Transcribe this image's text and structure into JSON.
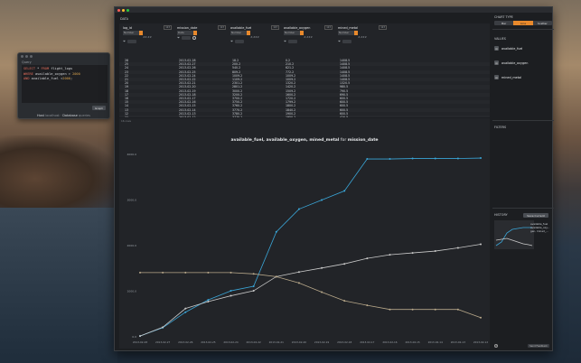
{
  "query_window": {
    "label": "Query",
    "sql_lines": [
      [
        {
          "t": "SELECT ",
          "c": "kw"
        },
        {
          "t": "* ",
          "c": "plain"
        },
        {
          "t": "FROM ",
          "c": "kw"
        },
        {
          "t": "flight_logs",
          "c": "plain"
        }
      ],
      [
        {
          "t": "WHERE ",
          "c": "kw"
        },
        {
          "t": "available_oxygen ",
          "c": "plain"
        },
        {
          "t": "> ",
          "c": "plain"
        },
        {
          "t": "2000",
          "c": "num"
        }
      ],
      [
        {
          "t": "AND ",
          "c": "kw"
        },
        {
          "t": "available_fuel ",
          "c": "plain"
        },
        {
          "t": "<",
          "c": "plain"
        },
        {
          "t": "2000",
          "c": "num"
        },
        {
          "t": ";",
          "c": "plain"
        }
      ]
    ],
    "run_label": "Graph",
    "footer_main": "Host",
    "footer_localhost": "localhost",
    "footer_db": "Database",
    "footer_queries": "queries"
  },
  "main": {
    "data_title": "DATA",
    "columns": [
      {
        "name": "log_id",
        "type": "Number",
        "sub": "##.##",
        "tag": "123"
      },
      {
        "name": "mission_date",
        "type": "Date",
        "sub": "",
        "tag": "123"
      },
      {
        "name": "available_fuel",
        "type": "Number",
        "sub": "#,###",
        "tag": "123"
      },
      {
        "name": "available_oxygen",
        "type": "Number",
        "sub": "#,###",
        "tag": "123"
      },
      {
        "name": "mined_metal",
        "type": "Number",
        "sub": "#,###",
        "tag": "123"
      }
    ],
    "rows": [
      [
        "28",
        "2013-02-28",
        "18.2",
        "0.2",
        "1408.5"
      ],
      [
        "25",
        "2013-02-27",
        "200.2",
        "210.2",
        "1408.5"
      ],
      [
        "24",
        "2013-02-26",
        "540.2",
        "621.2",
        "1408.5"
      ],
      [
        "23",
        "2013-02-25",
        "809.2",
        "772.2",
        "1408.5"
      ],
      [
        "22",
        "2013-02-24",
        "1009.2",
        "1009.2",
        "1408.5"
      ],
      [
        "21",
        "2013-02-22",
        "1109.2",
        "1009.2",
        "1408.5"
      ],
      [
        "20",
        "2013-02-21",
        "2301.2",
        "1320.2",
        "1320.5"
      ],
      [
        "19",
        "2013-02-20",
        "2801.2",
        "1420.2",
        "980.5"
      ],
      [
        "18",
        "2013-02-19",
        "3000.2",
        "1509.2",
        "790.5"
      ],
      [
        "17",
        "2013-02-18",
        "3200.2",
        "1600.2",
        "690.5"
      ],
      [
        "16",
        "2013-02-17",
        "3700.2",
        "1720.2",
        "600.5"
      ],
      [
        "15",
        "2013-02-16",
        "3750.2",
        "1799.2",
        "600.5"
      ],
      [
        "14",
        "2013-02-15",
        "3760.2",
        "1800.2",
        "600.5"
      ],
      [
        "13",
        "2013-02-14",
        "3770.2",
        "1840.2",
        "600.5"
      ],
      [
        "12",
        "2013-02-13",
        "3780.2",
        "1900.2",
        "600.5"
      ],
      [
        "11",
        "2013-02-12",
        "3770.2",
        "1950.2",
        "420.5"
      ]
    ],
    "chart_sublabel": "16 rows",
    "chart_title_bold": "available_fuel, available_oxygen, mined_metal",
    "chart_title_for": " for ",
    "chart_title_x": "mission_date"
  },
  "side": {
    "chart_type_title": "CHART TYPE",
    "chart_types": [
      "Bar",
      "Line",
      "Scatter"
    ],
    "active_chart_type": 1,
    "values_title": "VALUES",
    "values": [
      "available_fuel",
      "available_oxygen",
      "mined_metal"
    ],
    "filters_title": "FILTERS",
    "history_title": "HISTORY",
    "save_label": "Save Current",
    "history_labels": [
      "available_fuel",
      "available_oxy...",
      "gen, mined_..."
    ],
    "bottom_button": "Send Feedback",
    "help": "?"
  },
  "colors": {
    "accent": "#e8892c",
    "fuel": "#3aa6d8",
    "oxygen": "#c9c9c9",
    "metal": "#b8a88a"
  },
  "chart_data": {
    "type": "line",
    "title": "available_fuel, available_oxygen, mined_metal for mission_date",
    "xlabel": "",
    "ylabel": "",
    "x": [
      "2013-02-28",
      "2013-02-27",
      "2013-02-26",
      "2013-02-25",
      "2013-02-24",
      "2013-02-22",
      "2013-02-21",
      "2013-02-20",
      "2013-02-19",
      "2013-02-18",
      "2013-02-17",
      "2013-02-16",
      "2013-02-15",
      "2013-02-14",
      "2013-02-13",
      "2013-02-12"
    ],
    "yticks": [
      "0.0",
      "1000.0",
      "2000.0",
      "3000.0",
      "4000.0"
    ],
    "ylim": [
      0,
      4000
    ],
    "series": [
      {
        "name": "available_fuel",
        "values": [
          18,
          200,
          540,
          809,
          1009,
          1109,
          2301,
          2801,
          3000,
          3200,
          3900,
          3900,
          3910,
          3910,
          3910,
          3920
        ]
      },
      {
        "name": "available_oxygen",
        "values": [
          18,
          210,
          621,
          772,
          900,
          1009,
          1320,
          1420,
          1509,
          1600,
          1720,
          1799,
          1840,
          1880,
          1950,
          2030
        ]
      },
      {
        "name": "mined_metal",
        "values": [
          1408,
          1408,
          1408,
          1408,
          1408,
          1380,
          1320,
          1180,
          980,
          790,
          690,
          600,
          600,
          600,
          600,
          420
        ]
      }
    ],
    "grid": false,
    "legend": "none"
  }
}
